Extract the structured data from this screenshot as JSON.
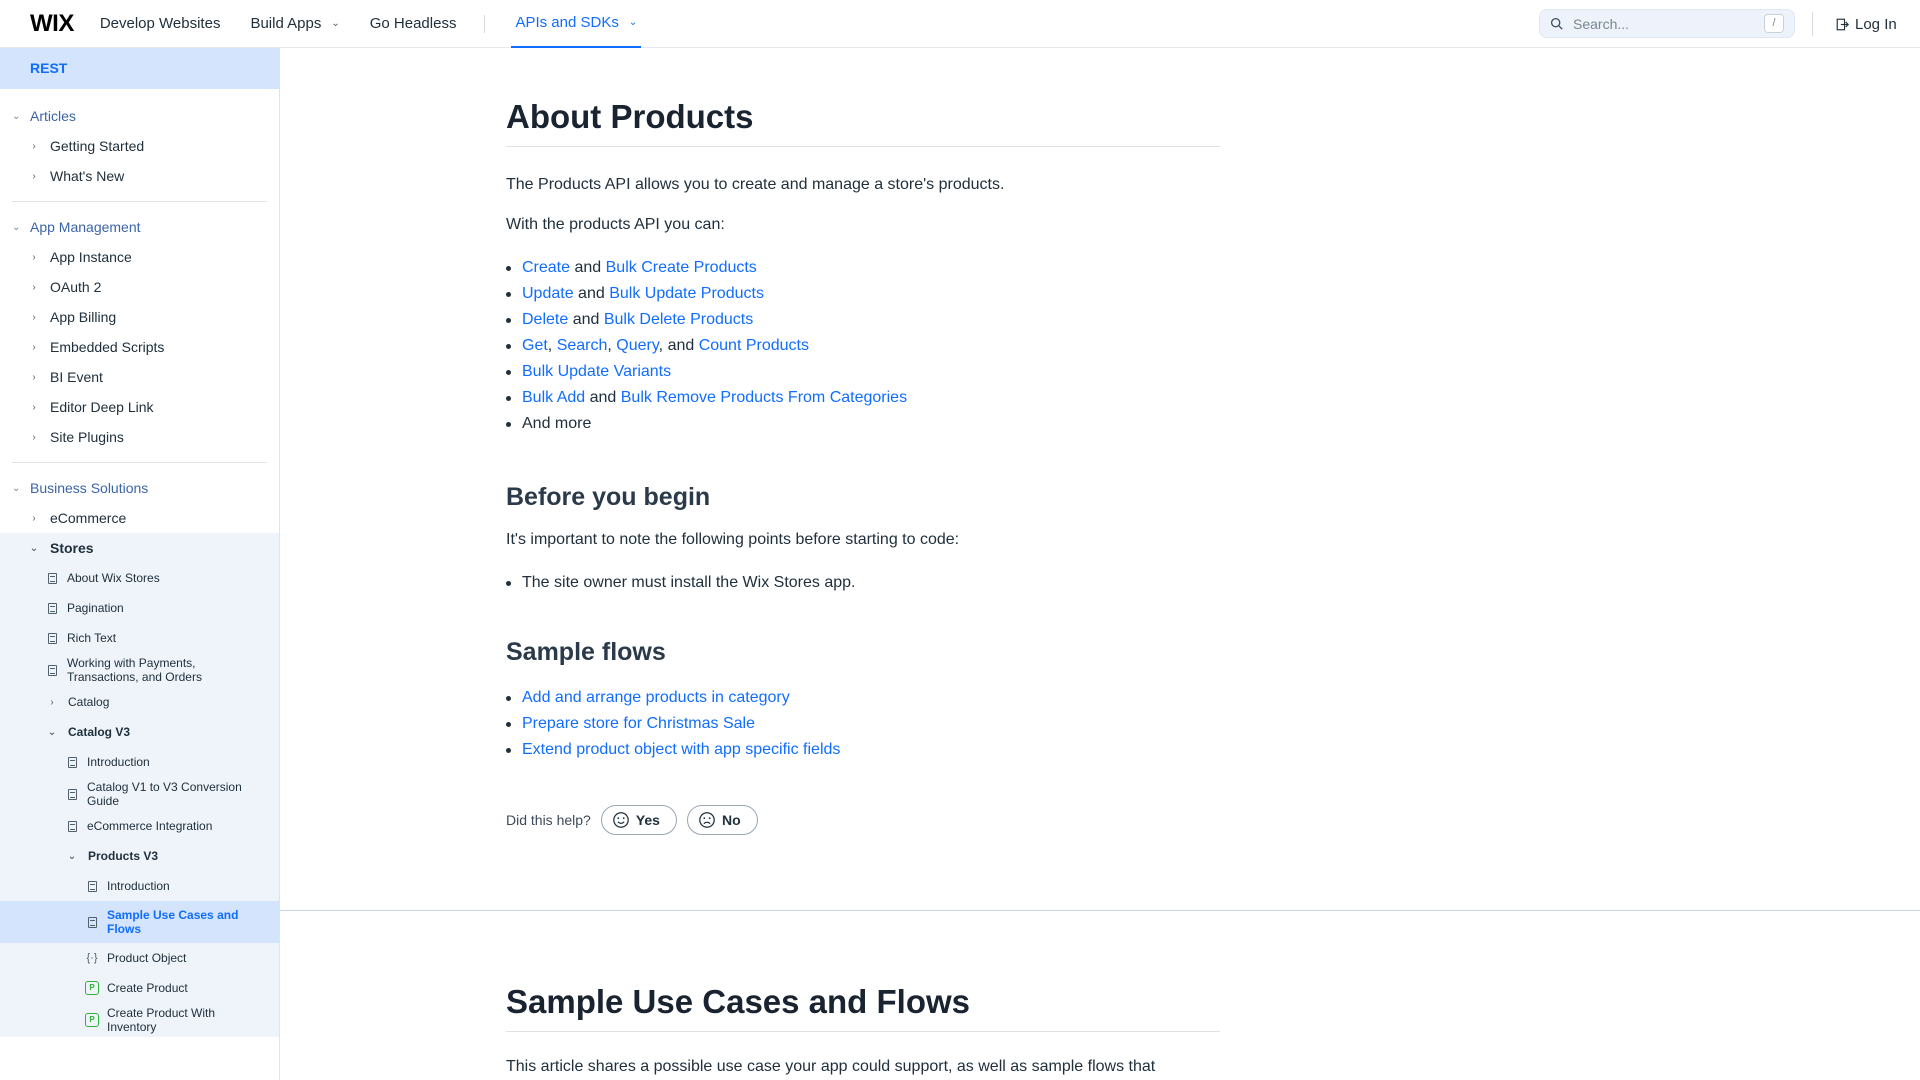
{
  "topbar": {
    "logo": "WIX",
    "nav": [
      {
        "label": "Develop Websites"
      },
      {
        "label": "Build Apps",
        "chevron": true
      },
      {
        "label": "Go Headless"
      }
    ],
    "active_nav": "APIs and SDKs",
    "search_placeholder": "Search...",
    "search_shortcut": "/",
    "login_label": "Log In"
  },
  "sidebar": {
    "header": "REST",
    "articles": {
      "title": "Articles",
      "items": [
        "Getting Started",
        "What's New"
      ]
    },
    "app_management": {
      "title": "App Management",
      "items": [
        "App Instance",
        "OAuth 2",
        "App Billing",
        "Embedded Scripts",
        "BI Event",
        "Editor Deep Link",
        "Site Plugins"
      ]
    },
    "business": {
      "title": "Business Solutions",
      "ecommerce": "eCommerce",
      "stores": "Stores",
      "stores_items": [
        "About Wix Stores",
        "Pagination",
        "Rich Text",
        "Working with Payments, Transactions, and Orders"
      ],
      "catalog": "Catalog",
      "catalog_v3": "Catalog V3",
      "catalog_v3_items": [
        "Introduction",
        "Catalog V1 to V3 Conversion Guide",
        "eCommerce Integration"
      ],
      "products_v3": "Products V3",
      "products_v3_items": {
        "introduction": "Introduction",
        "sample_use_cases": "Sample Use Cases and Flows",
        "product_object": "Product Object",
        "create_product": "Create Product",
        "create_product_inventory": "Create Product With Inventory"
      },
      "method_badge": "P"
    }
  },
  "main": {
    "title": "About Products",
    "intro": "The Products API allows you to create and manage a store's products.",
    "can_label": "With the products API you can:",
    "bullets": {
      "b1": {
        "a": "Create",
        "sep": " and ",
        "b": "Bulk Create Products"
      },
      "b2": {
        "a": "Update",
        "sep": " and ",
        "b": "Bulk Update Products"
      },
      "b3": {
        "a": "Delete",
        "sep": " and ",
        "b": "Bulk Delete Products"
      },
      "b4": {
        "a": "Get",
        "s1": ", ",
        "b": "Search",
        "s2": ", ",
        "c": "Query",
        "s3": ", and ",
        "d": "Count Products"
      },
      "b5": {
        "a": "Bulk Update Variants"
      },
      "b6": {
        "a": "Bulk Add",
        "sep": " and ",
        "b": "Bulk Remove Products From Categories"
      },
      "b7": "And more"
    },
    "before_title": "Before you begin",
    "before_text": "It's important to note the following points before starting to code:",
    "before_bullet": "The site owner must install the Wix Stores app.",
    "flows_title": "Sample flows",
    "flows": [
      "Add and arrange products in category",
      "Prepare store for Christmas Sale",
      "Extend product object with app specific fields"
    ],
    "feedback_label": "Did this help?",
    "yes": "Yes",
    "no": "No",
    "next_title": "Sample Use Cases and Flows",
    "next_text": "This article shares a possible use case your app could support, as well as sample flows that"
  }
}
